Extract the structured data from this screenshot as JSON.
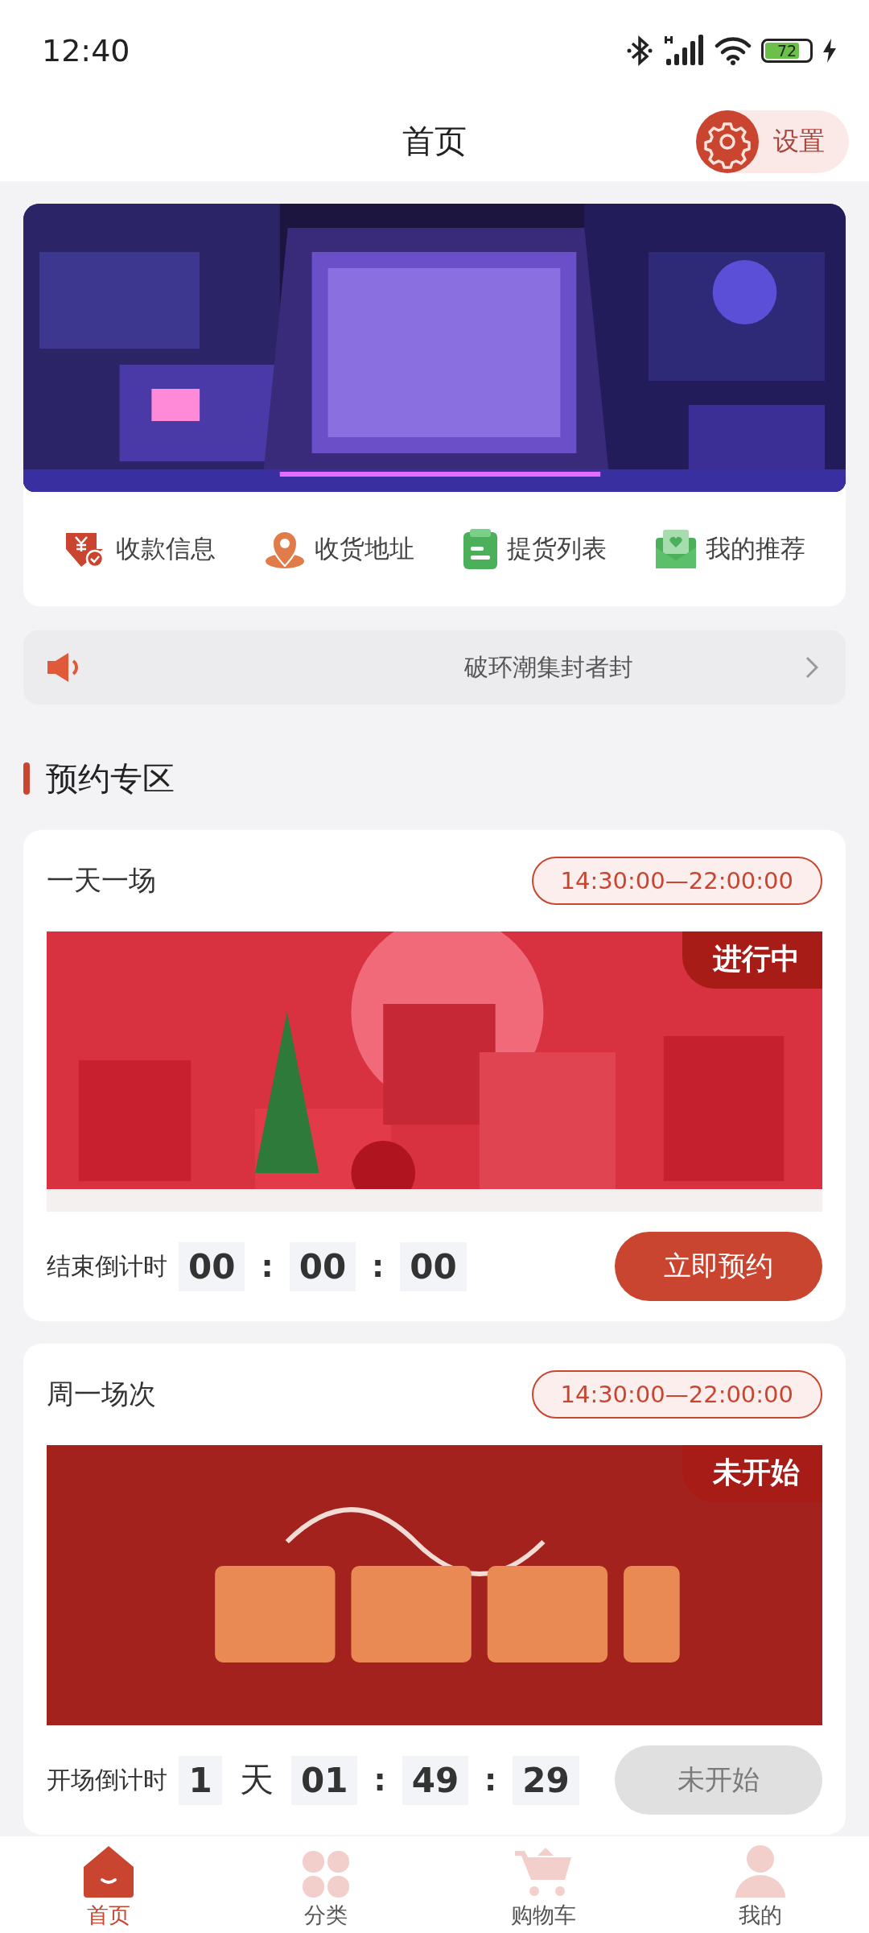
{
  "status_bar": {
    "time": "12:40",
    "battery": "72"
  },
  "header": {
    "title": "首页",
    "settings_label": "设置"
  },
  "quick_links": [
    {
      "kind": "payment",
      "label": "收款信息"
    },
    {
      "kind": "address",
      "label": "收货地址"
    },
    {
      "kind": "pickup",
      "label": "提货列表"
    },
    {
      "kind": "referral",
      "label": "我的推荐"
    }
  ],
  "notice": {
    "text": "破环潮集封者封"
  },
  "section": {
    "title": "预约专区"
  },
  "sessions": [
    {
      "title": "一天一场",
      "time_range": "14:30:00—22:00:00",
      "badge": "进行中",
      "countdown_label": "结束倒计时",
      "countdown": [
        {
          "kind": "box",
          "text": "00"
        },
        {
          "kind": "sep",
          "text": ":"
        },
        {
          "kind": "box",
          "text": "00"
        },
        {
          "kind": "sep",
          "text": ":"
        },
        {
          "kind": "box",
          "text": "00"
        }
      ],
      "button": "立即预约",
      "disabled": false
    },
    {
      "title": "周一场次",
      "time_range": "14:30:00—22:00:00",
      "badge": "未开始",
      "countdown_label": "开场倒计时",
      "countdown": [
        {
          "kind": "box",
          "text": "1"
        },
        {
          "kind": "unit",
          "text": "天"
        },
        {
          "kind": "box",
          "text": "01"
        },
        {
          "kind": "sep",
          "text": ":"
        },
        {
          "kind": "box",
          "text": "49"
        },
        {
          "kind": "sep",
          "text": ":"
        },
        {
          "kind": "box",
          "text": "29"
        }
      ],
      "button": "未开始",
      "disabled": true
    }
  ],
  "nav": [
    {
      "kind": "home",
      "label": "首页",
      "selected": true
    },
    {
      "kind": "category",
      "label": "分类",
      "selected": false
    },
    {
      "kind": "cart",
      "label": "购物车",
      "selected": false
    },
    {
      "kind": "profile",
      "label": "我的",
      "selected": false
    }
  ]
}
